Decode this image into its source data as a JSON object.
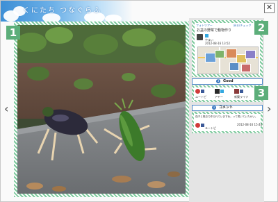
{
  "header": {
    "site_title": "くにたち つなぐらふ"
  },
  "controls": {
    "close_glyph": "✕",
    "prev_glyph": "‹",
    "next_glyph": "›"
  },
  "badges": {
    "photo": "1",
    "post": "2",
    "feedback": "3"
  },
  "post": {
    "top_left": "フォトツアー",
    "top_right": "戻る/チェック",
    "caption": "お盆の野菜で動物作り",
    "author": "やまい",
    "date": "2012-08-16 13:52"
  },
  "good": {
    "label": "Good",
    "count_icon": "3",
    "users": [
      "ユートピ",
      "アヤー",
      "新築ライフ"
    ]
  },
  "comments": {
    "label": "コメント",
    "count_icon": "1",
    "text": "茄子と胡瓜で作られていますね。って書いていたかい。",
    "author": "ユートピ",
    "date": "2012-08-16 15:44"
  },
  "colors": {
    "stripe_green": "#7cc99c",
    "badge_green": "#5cae7a",
    "section_blue": "#3a78c0"
  }
}
